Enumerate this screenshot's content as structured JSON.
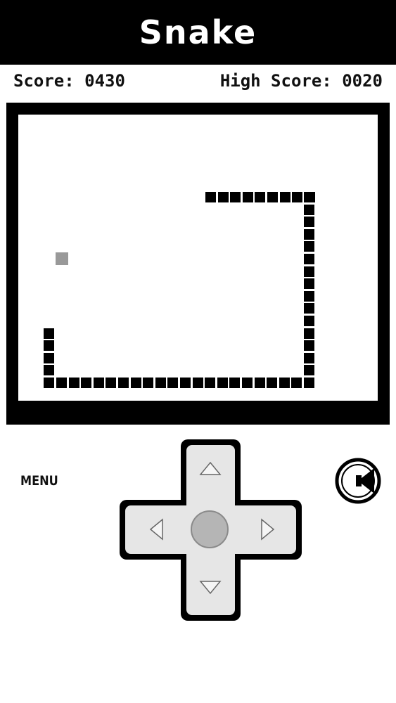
{
  "header": {
    "title": "Snake"
  },
  "scoreboard": {
    "score_text": "Score: 0430",
    "high_score_text": "High Score: 0020"
  },
  "controls": {
    "menu_label": "MENU",
    "sound_icon": "speaker-icon",
    "dpad_icons": [
      "up-arrow-icon",
      "down-arrow-icon",
      "left-arrow-icon",
      "right-arrow-icon"
    ]
  },
  "colors": {
    "header_bg": "#000000",
    "header_text": "#ffffff",
    "snake": "#000000",
    "food": "#999999",
    "dpad_fill": "#e6e6e6",
    "dpad_center": "#b5b5b5"
  }
}
